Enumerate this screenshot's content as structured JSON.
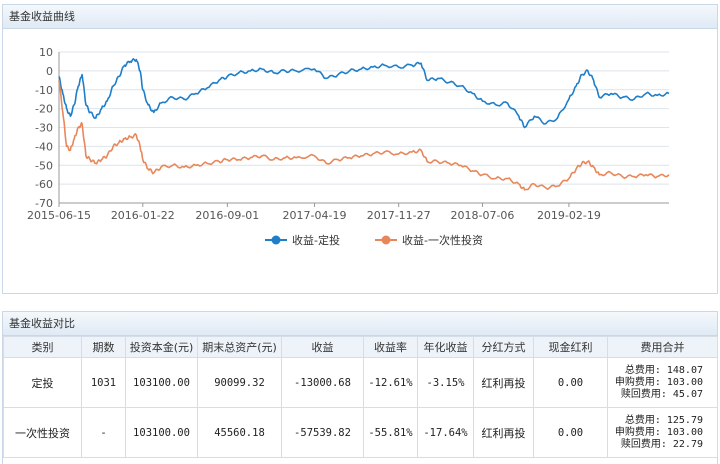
{
  "chart_panel": {
    "title": "基金收益曲线"
  },
  "table_panel": {
    "title": "基金收益对比"
  },
  "colors": {
    "dingtou": "#1f7ec9",
    "yici": "#e8875a",
    "grid": "#dde4ec",
    "axis": "#555555"
  },
  "chart_data": {
    "type": "line",
    "ylim": [
      -70,
      10
    ],
    "y_ticks": [
      10,
      0,
      -10,
      -20,
      -30,
      -40,
      -50,
      -60,
      -70
    ],
    "x_ticks": [
      "2015-06-15",
      "2016-01-22",
      "2016-09-01",
      "2017-04-19",
      "2017-11-27",
      "2018-07-06",
      "2019-02-19"
    ],
    "legend_position": "bottom",
    "grid": true,
    "series": [
      {
        "name": "收益-定投",
        "color": "#1f7ec9",
        "points": [
          [
            "2015-06-15",
            -3
          ],
          [
            "2015-06-25",
            -12
          ],
          [
            "2015-07-05",
            -20
          ],
          [
            "2015-07-15",
            -24
          ],
          [
            "2015-07-25",
            -18
          ],
          [
            "2015-08-05",
            -8
          ],
          [
            "2015-08-15",
            -2
          ],
          [
            "2015-08-25",
            -18
          ],
          [
            "2015-09-05",
            -22
          ],
          [
            "2015-09-20",
            -25
          ],
          [
            "2015-10-05",
            -20
          ],
          [
            "2015-10-20",
            -16
          ],
          [
            "2015-11-05",
            -8
          ],
          [
            "2015-11-20",
            -3
          ],
          [
            "2015-12-05",
            3
          ],
          [
            "2015-12-20",
            5
          ],
          [
            "2016-01-05",
            6
          ],
          [
            "2016-01-15",
            0
          ],
          [
            "2016-01-22",
            -10
          ],
          [
            "2016-02-05",
            -18
          ],
          [
            "2016-02-20",
            -22
          ],
          [
            "2016-03-10",
            -17
          ],
          [
            "2016-04-10",
            -14
          ],
          [
            "2016-05-10",
            -15
          ],
          [
            "2016-06-10",
            -12
          ],
          [
            "2016-07-10",
            -9
          ],
          [
            "2016-08-10",
            -5
          ],
          [
            "2016-09-01",
            -3
          ],
          [
            "2016-10-01",
            -1
          ],
          [
            "2016-11-01",
            0
          ],
          [
            "2016-12-01",
            1
          ],
          [
            "2017-01-01",
            -1
          ],
          [
            "2017-02-01",
            0
          ],
          [
            "2017-03-01",
            0
          ],
          [
            "2017-04-19",
            1
          ],
          [
            "2017-05-20",
            -4
          ],
          [
            "2017-06-20",
            -2
          ],
          [
            "2017-07-20",
            0
          ],
          [
            "2017-08-20",
            1
          ],
          [
            "2017-09-20",
            2
          ],
          [
            "2017-10-20",
            3
          ],
          [
            "2017-11-27",
            2
          ],
          [
            "2018-01-01",
            3
          ],
          [
            "2018-01-25",
            4
          ],
          [
            "2018-02-10",
            -5
          ],
          [
            "2018-03-10",
            -4
          ],
          [
            "2018-04-10",
            -6
          ],
          [
            "2018-05-10",
            -8
          ],
          [
            "2018-06-10",
            -12
          ],
          [
            "2018-07-06",
            -16
          ],
          [
            "2018-08-10",
            -18
          ],
          [
            "2018-09-10",
            -17
          ],
          [
            "2018-10-10",
            -24
          ],
          [
            "2018-10-25",
            -30
          ],
          [
            "2018-11-20",
            -24
          ],
          [
            "2018-12-20",
            -28
          ],
          [
            "2019-01-20",
            -25
          ],
          [
            "2019-02-19",
            -15
          ],
          [
            "2019-03-10",
            -8
          ],
          [
            "2019-03-25",
            -2
          ],
          [
            "2019-04-10",
            0
          ],
          [
            "2019-04-25",
            -5
          ],
          [
            "2019-05-10",
            -14
          ],
          [
            "2019-06-10",
            -12
          ],
          [
            "2019-07-10",
            -14
          ],
          [
            "2019-08-10",
            -15
          ],
          [
            "2019-09-10",
            -12
          ],
          [
            "2019-10-10",
            -13
          ],
          [
            "2019-11-10",
            -12
          ]
        ]
      },
      {
        "name": "收益-一次性投资",
        "color": "#e8875a",
        "points": [
          [
            "2015-06-15",
            -5
          ],
          [
            "2015-06-25",
            -22
          ],
          [
            "2015-07-05",
            -40
          ],
          [
            "2015-07-15",
            -42
          ],
          [
            "2015-07-25",
            -36
          ],
          [
            "2015-08-05",
            -30
          ],
          [
            "2015-08-15",
            -28
          ],
          [
            "2015-08-25",
            -45
          ],
          [
            "2015-09-05",
            -47
          ],
          [
            "2015-09-20",
            -49
          ],
          [
            "2015-10-05",
            -47
          ],
          [
            "2015-10-20",
            -45
          ],
          [
            "2015-11-05",
            -40
          ],
          [
            "2015-11-20",
            -38
          ],
          [
            "2015-12-05",
            -36
          ],
          [
            "2015-12-20",
            -35
          ],
          [
            "2016-01-05",
            -34
          ],
          [
            "2016-01-15",
            -40
          ],
          [
            "2016-01-22",
            -47
          ],
          [
            "2016-02-05",
            -52
          ],
          [
            "2016-02-20",
            -54
          ],
          [
            "2016-03-10",
            -51
          ],
          [
            "2016-04-10",
            -50
          ],
          [
            "2016-05-10",
            -51
          ],
          [
            "2016-06-10",
            -50
          ],
          [
            "2016-07-10",
            -49
          ],
          [
            "2016-08-10",
            -48
          ],
          [
            "2016-09-01",
            -47
          ],
          [
            "2016-10-01",
            -47
          ],
          [
            "2016-11-01",
            -46
          ],
          [
            "2016-12-01",
            -45
          ],
          [
            "2017-01-01",
            -47
          ],
          [
            "2017-02-01",
            -46
          ],
          [
            "2017-03-01",
            -46
          ],
          [
            "2017-04-19",
            -45
          ],
          [
            "2017-05-20",
            -49
          ],
          [
            "2017-06-20",
            -47
          ],
          [
            "2017-07-20",
            -46
          ],
          [
            "2017-08-20",
            -45
          ],
          [
            "2017-09-20",
            -44
          ],
          [
            "2017-10-20",
            -43
          ],
          [
            "2017-11-27",
            -44
          ],
          [
            "2018-01-01",
            -43
          ],
          [
            "2018-01-25",
            -42
          ],
          [
            "2018-02-10",
            -48
          ],
          [
            "2018-03-10",
            -48
          ],
          [
            "2018-04-10",
            -49
          ],
          [
            "2018-05-10",
            -50
          ],
          [
            "2018-06-10",
            -53
          ],
          [
            "2018-07-06",
            -55
          ],
          [
            "2018-08-10",
            -57
          ],
          [
            "2018-09-10",
            -57
          ],
          [
            "2018-10-10",
            -60
          ],
          [
            "2018-10-25",
            -63
          ],
          [
            "2018-11-20",
            -60
          ],
          [
            "2018-12-20",
            -62
          ],
          [
            "2019-01-20",
            -61
          ],
          [
            "2019-02-19",
            -57
          ],
          [
            "2019-03-10",
            -52
          ],
          [
            "2019-03-25",
            -49
          ],
          [
            "2019-04-10",
            -48
          ],
          [
            "2019-04-25",
            -51
          ],
          [
            "2019-05-10",
            -55
          ],
          [
            "2019-06-10",
            -54
          ],
          [
            "2019-07-10",
            -56
          ],
          [
            "2019-08-10",
            -56
          ],
          [
            "2019-09-10",
            -55
          ],
          [
            "2019-10-10",
            -56
          ],
          [
            "2019-11-10",
            -55
          ]
        ]
      }
    ]
  },
  "table": {
    "headers": [
      "类别",
      "期数",
      "投资本金(元)",
      "期末总资产(元)",
      "收益",
      "收益率",
      "年化收益",
      "分红方式",
      "现金红利",
      "费用合并"
    ],
    "rows": [
      {
        "category": "定投",
        "periods": "1031",
        "principal": "103100.00",
        "total_assets": "90099.32",
        "profit": "-13000.68",
        "return_rate": "-12.61%",
        "annualized": "-3.15%",
        "dividend_method": "红利再投",
        "cash_dividend": "0.00",
        "fees": [
          "总费用: 148.07",
          "申购费用: 103.00",
          "赎回费用: 45.07"
        ]
      },
      {
        "category": "一次性投资",
        "periods": "-",
        "principal": "103100.00",
        "total_assets": "45560.18",
        "profit": "-57539.82",
        "return_rate": "-55.81%",
        "annualized": "-17.64%",
        "dividend_method": "红利再投",
        "cash_dividend": "0.00",
        "fees": [
          "总费用: 125.79",
          "申购费用: 103.00",
          "赎回费用: 22.79"
        ]
      }
    ]
  }
}
